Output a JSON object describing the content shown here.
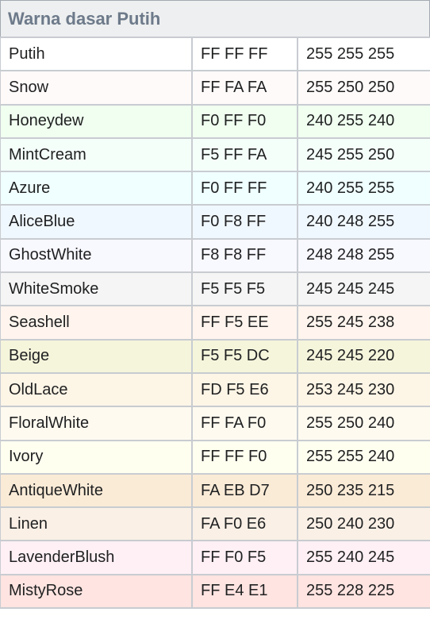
{
  "title": "Warna dasar Putih",
  "rows": [
    {
      "name": "Putih",
      "hex": "FF FF FF",
      "rgb": "255 255 255",
      "color": "#FFFFFF"
    },
    {
      "name": "Snow",
      "hex": "FF FA FA",
      "rgb": "255 250 250",
      "color": "#FFFAFA"
    },
    {
      "name": "Honeydew",
      "hex": "F0 FF F0",
      "rgb": "240 255 240",
      "color": "#F0FFF0"
    },
    {
      "name": "MintCream",
      "hex": "F5 FF FA",
      "rgb": "245 255 250",
      "color": "#F5FFFA"
    },
    {
      "name": "Azure",
      "hex": "F0 FF FF",
      "rgb": "240 255 255",
      "color": "#F0FFFF"
    },
    {
      "name": "AliceBlue",
      "hex": "F0 F8 FF",
      "rgb": "240 248 255",
      "color": "#F0F8FF"
    },
    {
      "name": "GhostWhite",
      "hex": "F8 F8 FF",
      "rgb": "248 248 255",
      "color": "#F8F8FF"
    },
    {
      "name": "WhiteSmoke",
      "hex": "F5 F5 F5",
      "rgb": "245 245 245",
      "color": "#F5F5F5"
    },
    {
      "name": "Seashell",
      "hex": "FF F5 EE",
      "rgb": "255 245 238",
      "color": "#FFF5EE"
    },
    {
      "name": "Beige",
      "hex": "F5 F5 DC",
      "rgb": "245 245 220",
      "color": "#F5F5DC"
    },
    {
      "name": "OldLace",
      "hex": "FD F5 E6",
      "rgb": "253 245 230",
      "color": "#FDF5E6"
    },
    {
      "name": "FloralWhite",
      "hex": "FF FA F0",
      "rgb": "255 250 240",
      "color": "#FFFAF0"
    },
    {
      "name": "Ivory",
      "hex": "FF FF F0",
      "rgb": "255 255 240",
      "color": "#FFFFF0"
    },
    {
      "name": "AntiqueWhite",
      "hex": "FA EB D7",
      "rgb": "250 235 215",
      "color": "#FAEBD7"
    },
    {
      "name": "Linen",
      "hex": "FA F0 E6",
      "rgb": "250 240 230",
      "color": "#FAF0E6"
    },
    {
      "name": "LavenderBlush",
      "hex": "FF F0 F5",
      "rgb": "255 240 245",
      "color": "#FFF0F5"
    },
    {
      "name": "MistyRose",
      "hex": "FF E4 E1",
      "rgb": "255 228 225",
      "color": "#FFE4E1"
    }
  ]
}
